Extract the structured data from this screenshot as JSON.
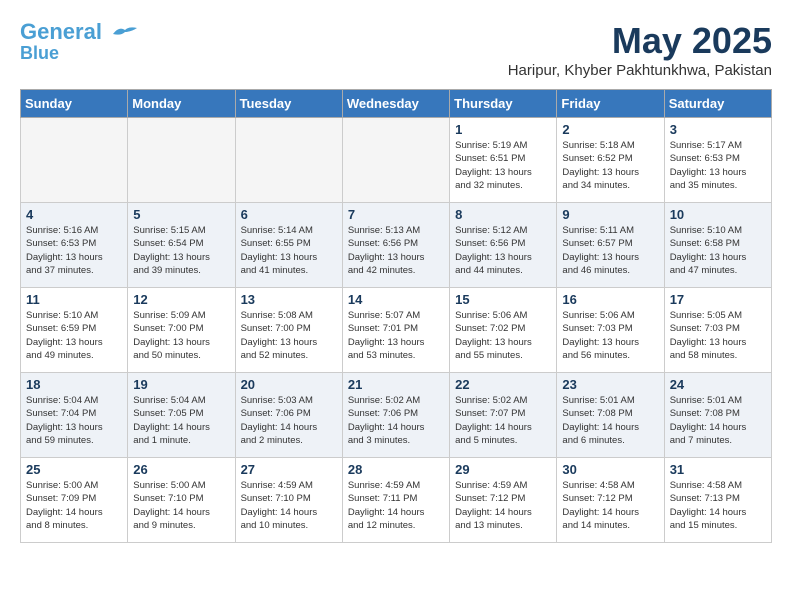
{
  "header": {
    "logo_line1": "General",
    "logo_line2": "Blue",
    "month": "May 2025",
    "location": "Haripur, Khyber Pakhtunkhwa, Pakistan"
  },
  "weekdays": [
    "Sunday",
    "Monday",
    "Tuesday",
    "Wednesday",
    "Thursday",
    "Friday",
    "Saturday"
  ],
  "weeks": [
    [
      {
        "day": "",
        "info": ""
      },
      {
        "day": "",
        "info": ""
      },
      {
        "day": "",
        "info": ""
      },
      {
        "day": "",
        "info": ""
      },
      {
        "day": "1",
        "info": "Sunrise: 5:19 AM\nSunset: 6:51 PM\nDaylight: 13 hours\nand 32 minutes."
      },
      {
        "day": "2",
        "info": "Sunrise: 5:18 AM\nSunset: 6:52 PM\nDaylight: 13 hours\nand 34 minutes."
      },
      {
        "day": "3",
        "info": "Sunrise: 5:17 AM\nSunset: 6:53 PM\nDaylight: 13 hours\nand 35 minutes."
      }
    ],
    [
      {
        "day": "4",
        "info": "Sunrise: 5:16 AM\nSunset: 6:53 PM\nDaylight: 13 hours\nand 37 minutes."
      },
      {
        "day": "5",
        "info": "Sunrise: 5:15 AM\nSunset: 6:54 PM\nDaylight: 13 hours\nand 39 minutes."
      },
      {
        "day": "6",
        "info": "Sunrise: 5:14 AM\nSunset: 6:55 PM\nDaylight: 13 hours\nand 41 minutes."
      },
      {
        "day": "7",
        "info": "Sunrise: 5:13 AM\nSunset: 6:56 PM\nDaylight: 13 hours\nand 42 minutes."
      },
      {
        "day": "8",
        "info": "Sunrise: 5:12 AM\nSunset: 6:56 PM\nDaylight: 13 hours\nand 44 minutes."
      },
      {
        "day": "9",
        "info": "Sunrise: 5:11 AM\nSunset: 6:57 PM\nDaylight: 13 hours\nand 46 minutes."
      },
      {
        "day": "10",
        "info": "Sunrise: 5:10 AM\nSunset: 6:58 PM\nDaylight: 13 hours\nand 47 minutes."
      }
    ],
    [
      {
        "day": "11",
        "info": "Sunrise: 5:10 AM\nSunset: 6:59 PM\nDaylight: 13 hours\nand 49 minutes."
      },
      {
        "day": "12",
        "info": "Sunrise: 5:09 AM\nSunset: 7:00 PM\nDaylight: 13 hours\nand 50 minutes."
      },
      {
        "day": "13",
        "info": "Sunrise: 5:08 AM\nSunset: 7:00 PM\nDaylight: 13 hours\nand 52 minutes."
      },
      {
        "day": "14",
        "info": "Sunrise: 5:07 AM\nSunset: 7:01 PM\nDaylight: 13 hours\nand 53 minutes."
      },
      {
        "day": "15",
        "info": "Sunrise: 5:06 AM\nSunset: 7:02 PM\nDaylight: 13 hours\nand 55 minutes."
      },
      {
        "day": "16",
        "info": "Sunrise: 5:06 AM\nSunset: 7:03 PM\nDaylight: 13 hours\nand 56 minutes."
      },
      {
        "day": "17",
        "info": "Sunrise: 5:05 AM\nSunset: 7:03 PM\nDaylight: 13 hours\nand 58 minutes."
      }
    ],
    [
      {
        "day": "18",
        "info": "Sunrise: 5:04 AM\nSunset: 7:04 PM\nDaylight: 13 hours\nand 59 minutes."
      },
      {
        "day": "19",
        "info": "Sunrise: 5:04 AM\nSunset: 7:05 PM\nDaylight: 14 hours\nand 1 minute."
      },
      {
        "day": "20",
        "info": "Sunrise: 5:03 AM\nSunset: 7:06 PM\nDaylight: 14 hours\nand 2 minutes."
      },
      {
        "day": "21",
        "info": "Sunrise: 5:02 AM\nSunset: 7:06 PM\nDaylight: 14 hours\nand 3 minutes."
      },
      {
        "day": "22",
        "info": "Sunrise: 5:02 AM\nSunset: 7:07 PM\nDaylight: 14 hours\nand 5 minutes."
      },
      {
        "day": "23",
        "info": "Sunrise: 5:01 AM\nSunset: 7:08 PM\nDaylight: 14 hours\nand 6 minutes."
      },
      {
        "day": "24",
        "info": "Sunrise: 5:01 AM\nSunset: 7:08 PM\nDaylight: 14 hours\nand 7 minutes."
      }
    ],
    [
      {
        "day": "25",
        "info": "Sunrise: 5:00 AM\nSunset: 7:09 PM\nDaylight: 14 hours\nand 8 minutes."
      },
      {
        "day": "26",
        "info": "Sunrise: 5:00 AM\nSunset: 7:10 PM\nDaylight: 14 hours\nand 9 minutes."
      },
      {
        "day": "27",
        "info": "Sunrise: 4:59 AM\nSunset: 7:10 PM\nDaylight: 14 hours\nand 10 minutes."
      },
      {
        "day": "28",
        "info": "Sunrise: 4:59 AM\nSunset: 7:11 PM\nDaylight: 14 hours\nand 12 minutes."
      },
      {
        "day": "29",
        "info": "Sunrise: 4:59 AM\nSunset: 7:12 PM\nDaylight: 14 hours\nand 13 minutes."
      },
      {
        "day": "30",
        "info": "Sunrise: 4:58 AM\nSunset: 7:12 PM\nDaylight: 14 hours\nand 14 minutes."
      },
      {
        "day": "31",
        "info": "Sunrise: 4:58 AM\nSunset: 7:13 PM\nDaylight: 14 hours\nand 15 minutes."
      }
    ]
  ]
}
